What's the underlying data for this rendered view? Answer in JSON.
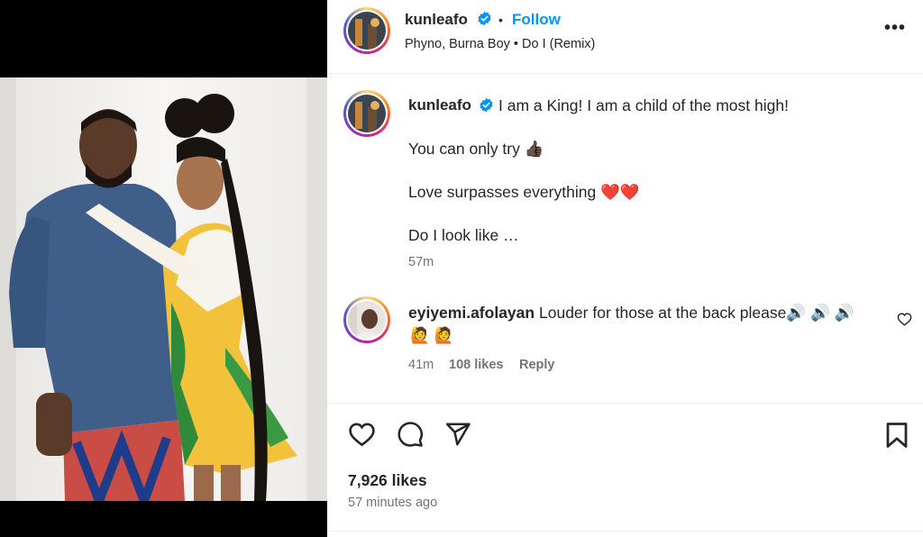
{
  "post": {
    "username": "kunleafo",
    "follow_label": "Follow",
    "dot": "•",
    "audio": "Phyno, Burna Boy • Do I (Remix)",
    "more_label": "•••"
  },
  "caption": {
    "username": "kunleafo",
    "line1": "I am a King! I am a child of the most high!",
    "line2": "You can only try 👍🏿",
    "line3": "Love surpasses everything ❤️❤️",
    "line4": "Do I look like …",
    "time": "57m"
  },
  "comment": {
    "username": "eyiyemi.afolayan",
    "text": "Louder for those at the back please🔊 🔊 🔊",
    "emojis": "🙋 🙋",
    "time": "41m",
    "likes": "108 likes",
    "reply_label": "Reply"
  },
  "actions": {
    "like_icon": "heart-icon",
    "comment_icon": "comment-icon",
    "share_icon": "share-icon",
    "save_icon": "bookmark-icon"
  },
  "footer": {
    "likes": "7,926 likes",
    "time_ago": "57 minutes ago"
  },
  "colors": {
    "follow": "#0095f6",
    "verified": "#0095f6",
    "muted": "#737373"
  }
}
